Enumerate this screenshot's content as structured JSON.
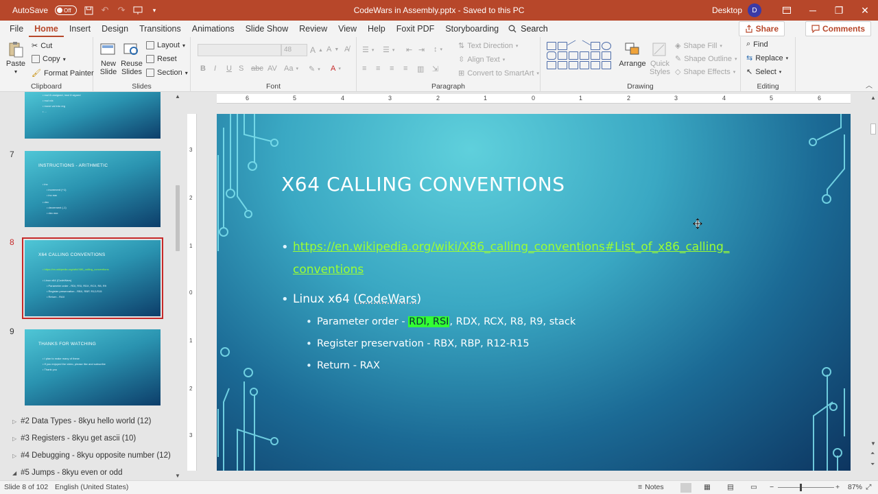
{
  "titlebar": {
    "autosave_label": "AutoSave",
    "autosave_state": "Off",
    "doc_title": "CodeWars in Assembly.pptx  -  Saved to this PC",
    "location": "Desktop",
    "avatar_initial": "D"
  },
  "tabs": [
    "File",
    "Home",
    "Insert",
    "Design",
    "Transitions",
    "Animations",
    "Slide Show",
    "Review",
    "View",
    "Help",
    "Foxit PDF",
    "Storyboarding"
  ],
  "active_tab": "Home",
  "search_label": "Search",
  "share_label": "Share",
  "comments_label": "Comments",
  "ribbon": {
    "clipboard": {
      "label": "Clipboard",
      "paste": "Paste",
      "cut": "Cut",
      "copy": "Copy",
      "format_painter": "Format Painter"
    },
    "slides": {
      "label": "Slides",
      "new_slide": "New Slide",
      "reuse_slides": "Reuse Slides",
      "layout": "Layout",
      "reset": "Reset",
      "section": "Section"
    },
    "font": {
      "label": "Font",
      "size": "48"
    },
    "paragraph": {
      "label": "Paragraph",
      "text_direction": "Text Direction",
      "align_text": "Align Text",
      "convert_smartart": "Convert to SmartArt"
    },
    "drawing": {
      "label": "Drawing",
      "arrange": "Arrange",
      "quick_styles": "Quick Styles",
      "shape_fill": "Shape Fill",
      "shape_outline": "Shape Outline",
      "shape_effects": "Shape Effects"
    },
    "editing": {
      "label": "Editing",
      "find": "Find",
      "replace": "Replace",
      "select": "Select"
    }
  },
  "thumbnails": [
    {
      "num": "",
      "title": "",
      "lines": [
        "• mul 8 unsigned, imul 8 signed",
        "• mul rdx",
        "• move val into reg",
        "• ... "
      ]
    },
    {
      "num": "7",
      "title": "INSTRUCTIONS - ARITHMETIC",
      "lines": [
        "• inc",
        "• increment (+1)",
        "• inc eax",
        "• dec",
        "• decrement (-1)",
        "• dec eax"
      ]
    },
    {
      "num": "8",
      "title": "X64 CALLING CONVENTIONS",
      "lines": [
        "• https://en.wikipedia.org/wiki/X86_calling_conventions",
        "• Linux x64 (CodeWars)",
        "• Parameter order - RDI, RSI, RDX, RCX, R8, R9",
        "• Register preservation - RBX, RBP, R12-R15",
        "• Return - RAX"
      ]
    },
    {
      "num": "9",
      "title": "THANKS FOR WATCHING",
      "lines": [
        "• I plan to make many of these",
        "• If you enjoyed the video, please like and subscribe",
        "• Thank you"
      ]
    }
  ],
  "sections": [
    "#2 Data Types - 8kyu hello world (12)",
    "#3 Registers - 8kyu get ascii (10)",
    "#4 Debugging - 8kyu opposite number (12)",
    "#5 Jumps - 8kyu even or odd"
  ],
  "ruler_top_labels": [
    "6",
    "5",
    "4",
    "3",
    "2",
    "1",
    "0",
    "1",
    "2",
    "3",
    "4",
    "5",
    "6"
  ],
  "ruler_left_labels": [
    "3",
    "2",
    "1",
    "0",
    "1",
    "2",
    "3"
  ],
  "slide": {
    "title": "X64 CALLING CONVENTIONS",
    "link_line1": "https://en.wikipedia.org/wiki/X86_calling_conventions#List_of_x86_calling_",
    "link_line2": "conventions",
    "linux_prefix": "Linux x64 (",
    "linux_codewars": "CodeWars",
    "linux_suffix": ")",
    "param_prefix": "Parameter order - ",
    "param_highlight": "RDI, RSI",
    "param_suffix": ", RDX, RCX, R8, R9, stack",
    "register_preservation": "Register preservation - RBX, RBP, R12-R15",
    "return": "Return - RAX"
  },
  "status": {
    "slide_info": "Slide 8 of 102",
    "language": "English (United States)",
    "notes": "Notes",
    "zoom": "87%"
  },
  "colors": {
    "accent": "#b7472a",
    "link": "#9cff33",
    "highlight": "#32ff32"
  }
}
